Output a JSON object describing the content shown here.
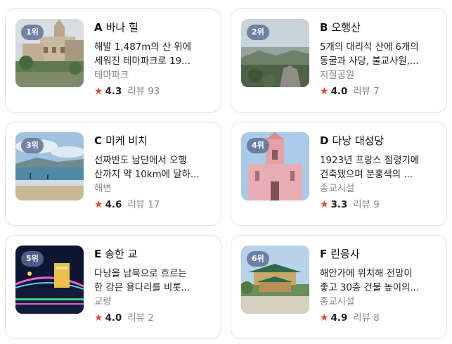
{
  "places": [
    {
      "rank": "1위",
      "letter": "A",
      "name": "바나 힐",
      "desc1": "해발 1,487m의 산 위에",
      "desc2": "세워진 테마파크로 19...",
      "category": "테마파크",
      "score": "4.3",
      "review": "리뷰 93",
      "thumb": "bana-hills-photo"
    },
    {
      "rank": "2위",
      "letter": "B",
      "name": "오행산",
      "desc1": "5개의 대리석 산에 6개의",
      "desc2": "동굴과 사당, 불교사원,...",
      "category": "지질공원",
      "score": "4.0",
      "review": "리뷰 7",
      "thumb": "marble-mountains-photo"
    },
    {
      "rank": "3위",
      "letter": "C",
      "name": "미케 비치",
      "desc1": "선짜반도 남단에서 오행",
      "desc2": "산까지 약 10km에 달하...",
      "category": "해변",
      "score": "4.6",
      "review": "리뷰 17",
      "thumb": "my-khe-beach-photo"
    },
    {
      "rank": "4위",
      "letter": "D",
      "name": "다낭 대성당",
      "desc1": "1923년 프랑스 점령기에",
      "desc2": "건축됐으며 분홍색의 ...",
      "category": "종교시설",
      "score": "3.3",
      "review": "리뷰 9",
      "thumb": "danang-cathedral-photo"
    },
    {
      "rank": "5위",
      "letter": "E",
      "name": "송한 교",
      "desc1": "다낭을 남북으로 흐르는",
      "desc2": "한 강은 용다리를 비롯...",
      "category": "교량",
      "score": "4.0",
      "review": "리뷰 2",
      "thumb": "song-han-bridge-photo"
    },
    {
      "rank": "6위",
      "letter": "F",
      "name": "린응사",
      "desc1": "해안가에 위치해 전망이",
      "desc2": "좋고 30층 건물 높이의...",
      "category": "종교시설",
      "score": "4.9",
      "review": "리뷰 8",
      "thumb": "linh-ung-pagoda-photo"
    }
  ],
  "icons": {
    "rating": "star-icon"
  },
  "colors": {
    "star": "#e4443b",
    "badge": "#5a6e96",
    "border": "#e3e3e3",
    "muted": "#888888"
  }
}
